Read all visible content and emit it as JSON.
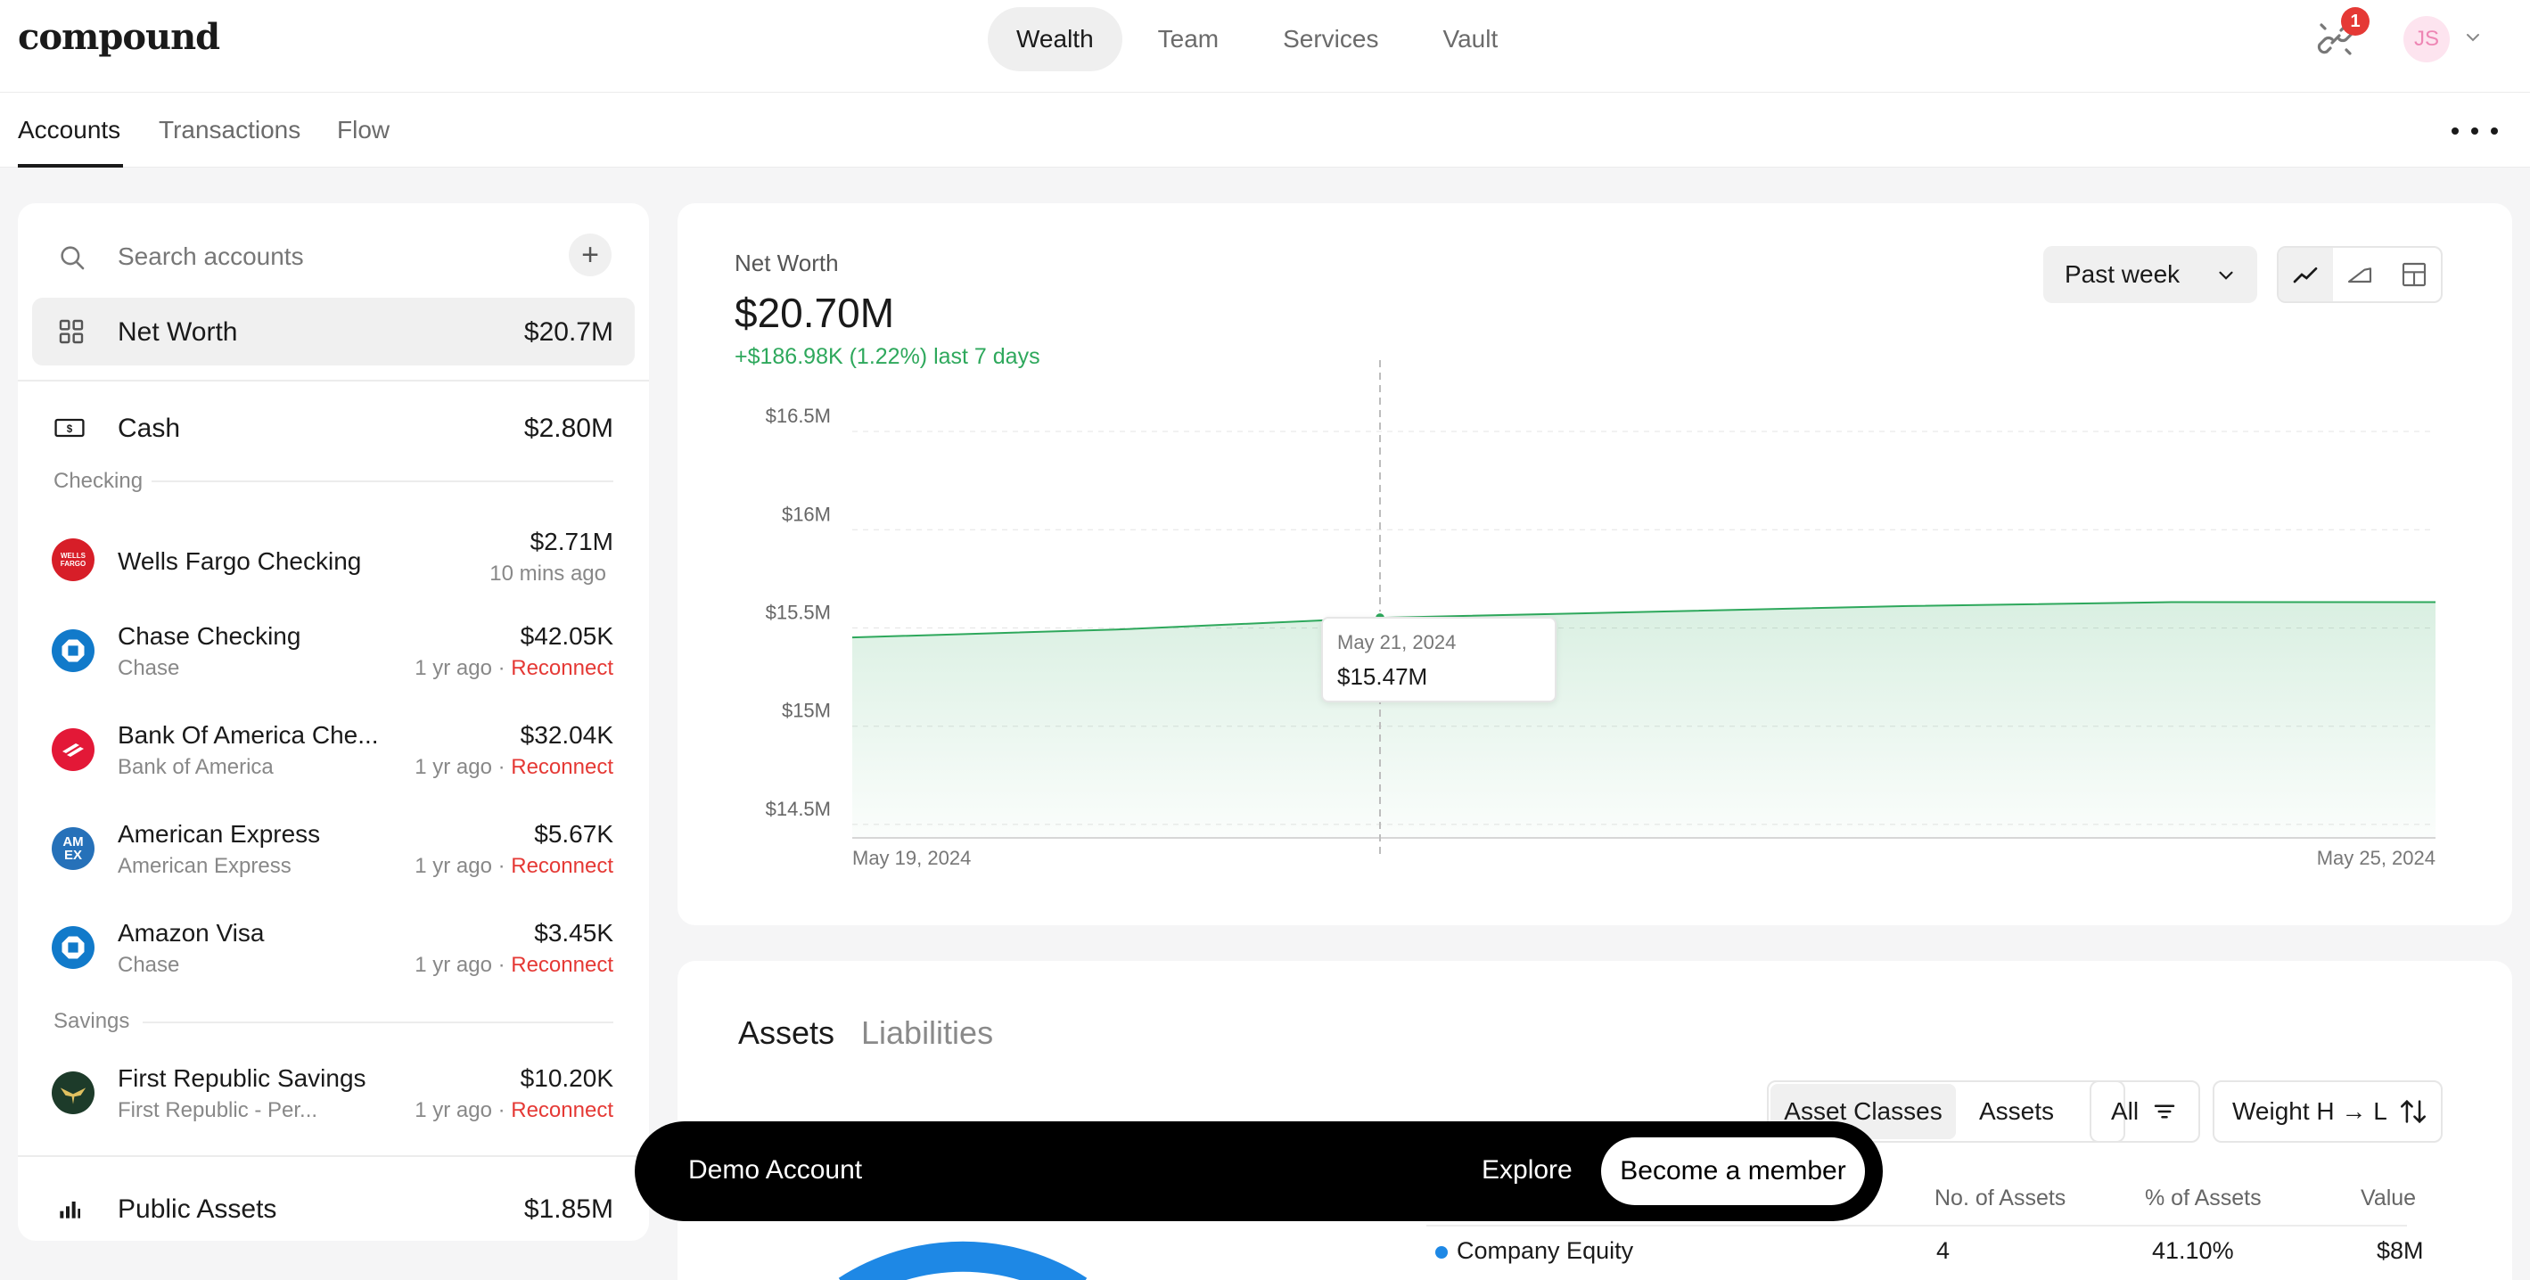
{
  "app": {
    "logo": "compound"
  },
  "topnav": {
    "items": [
      "Wealth",
      "Team",
      "Services",
      "Vault"
    ],
    "active": "Wealth"
  },
  "notifications": {
    "count": "1",
    "icon": "link-broken-icon"
  },
  "user": {
    "initials": "JS"
  },
  "subnav": {
    "tabs": [
      "Accounts",
      "Transactions",
      "Flow"
    ],
    "active": "Accounts"
  },
  "sidebar": {
    "search_placeholder": "Search accounts",
    "net_worth": {
      "label": "Net Worth",
      "value": "$20.7M"
    },
    "cash": {
      "label": "Cash",
      "value": "$2.80M"
    },
    "groups": {
      "checking": "Checking",
      "savings": "Savings"
    },
    "accounts": [
      {
        "name": "Wells Fargo Checking",
        "institution": "",
        "value": "$2.71M",
        "updated": "10 mins ago",
        "status": "",
        "logo_color": "#d71e28",
        "logo_text": "WELLS FARGO"
      },
      {
        "name": "Chase Checking",
        "institution": "Chase",
        "value": "$42.05K",
        "updated": "1 yr ago",
        "status": "Reconnect",
        "logo_color": "#117aca",
        "logo_text": ""
      },
      {
        "name": "Bank Of America Che...",
        "institution": "Bank of America",
        "value": "$32.04K",
        "updated": "1 yr ago",
        "status": "Reconnect",
        "logo_color": "#e31837",
        "logo_text": ""
      },
      {
        "name": "American Express",
        "institution": "American Express",
        "value": "$5.67K",
        "updated": "1 yr ago",
        "status": "Reconnect",
        "logo_color": "#2671b9",
        "logo_text": "AM EX"
      },
      {
        "name": "Amazon Visa",
        "institution": "Chase",
        "value": "$3.45K",
        "updated": "1 yr ago",
        "status": "Reconnect",
        "logo_color": "#117aca",
        "logo_text": ""
      },
      {
        "name": "First Republic Savings",
        "institution": "First Republic - Per...",
        "value": "$10.20K",
        "updated": "1 yr ago",
        "status": "Reconnect",
        "logo_color": "#1d3b2a",
        "logo_text": ""
      }
    ],
    "public_assets": {
      "label": "Public Assets",
      "value": "$1.85M"
    },
    "separator": " · "
  },
  "net_worth_card": {
    "title": "Net Worth",
    "value": "$20.70M",
    "change": "+$186.98K (1.22%) last 7 days",
    "period": "Past week",
    "view_icons": [
      "line-chart-icon",
      "area-chart-icon",
      "layout-grid-icon"
    ],
    "tooltip": {
      "date": "May 21, 2024",
      "value": "$15.47M"
    }
  },
  "chart_data": {
    "type": "area",
    "x_labels": [
      "May 19, 2024",
      "May 25, 2024"
    ],
    "y_ticks": [
      "$16.5M",
      "$16M",
      "$15.5M",
      "$15M",
      "$14.5M"
    ],
    "y_tick_values": [
      16.5,
      16,
      15.5,
      15,
      14.5
    ],
    "x": [
      "2024-05-19",
      "2024-05-20",
      "2024-05-21",
      "2024-05-22",
      "2024-05-23",
      "2024-05-24",
      "2024-05-25"
    ],
    "values": [
      15.37,
      15.41,
      15.47,
      15.5,
      15.53,
      15.55,
      15.55
    ],
    "ylim": [
      14.35,
      16.6
    ],
    "series_color": "#2ea85c",
    "grid": true
  },
  "assets_card": {
    "tabs": [
      "Assets",
      "Liabilities"
    ],
    "view_toggle": [
      "Asset Classes",
      "Assets"
    ],
    "filter": "All",
    "sort": "Weight H → L",
    "columns": [
      "No. of Assets",
      "% of Assets",
      "Value"
    ],
    "rows": [
      {
        "name": "Company Equity",
        "count": "4",
        "percent": "41.10%",
        "value": "$8M",
        "color": "#1e88e5"
      }
    ]
  },
  "demo_bar": {
    "label": "Demo Account",
    "explore": "Explore",
    "cta": "Become a member"
  }
}
